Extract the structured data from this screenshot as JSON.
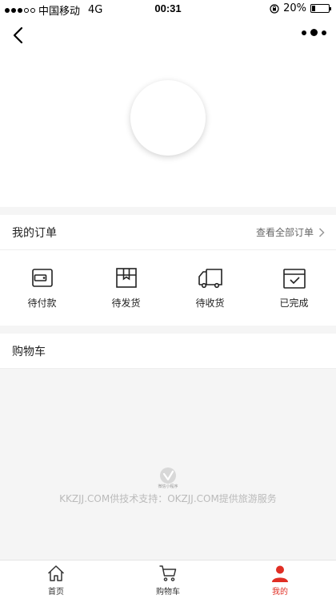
{
  "status_bar": {
    "carrier": "中国移动",
    "network": "4G",
    "time": "00:31",
    "battery_percent": "20%",
    "battery_level": 0.2
  },
  "nav": {
    "back_icon": "chevron-left-icon",
    "more_icon": "more-dots-icon"
  },
  "orders": {
    "title": "我的订单",
    "view_all": "查看全部订单",
    "items": [
      {
        "label": "待付款",
        "icon": "wallet-icon"
      },
      {
        "label": "待发货",
        "icon": "package-box-icon"
      },
      {
        "label": "待收货",
        "icon": "truck-icon"
      },
      {
        "label": "已完成",
        "icon": "check-calendar-icon"
      }
    ]
  },
  "cart": {
    "title": "购物车"
  },
  "footer": {
    "mini_program": "微信小程序",
    "text": "KKZJJ.COM供技术支持：OKZJJ.COM提供旅游服务"
  },
  "tabbar": {
    "tabs": [
      {
        "label": "首页",
        "icon": "home-icon"
      },
      {
        "label": "购物车",
        "icon": "cart-icon"
      },
      {
        "label": "我的",
        "icon": "user-icon",
        "active": true
      }
    ],
    "active_color": "#e02e24"
  }
}
